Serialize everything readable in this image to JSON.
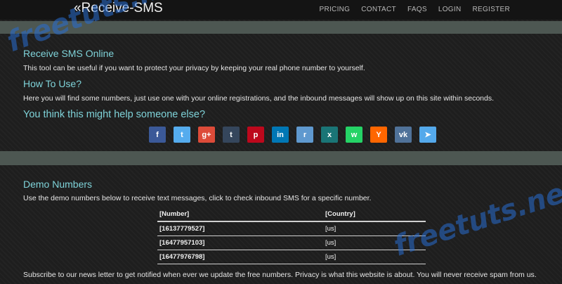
{
  "nav": {
    "brand": "«Receive-SMS",
    "items": [
      "PRICING",
      "CONTACT",
      "FAQS",
      "LOGIN",
      "REGISTER"
    ]
  },
  "intro": {
    "title": "Receive SMS Online",
    "text": "This tool can be useful if you want to protect your privacy by keeping your real phone number to yourself."
  },
  "howto": {
    "title": "How To Use?",
    "text": "Here you will find some numbers, just use one with your online registrations, and the inbound messages will show up on this site within seconds."
  },
  "share": {
    "title": "You think this might help someone else?",
    "buttons": [
      {
        "name": "facebook",
        "glyph": "f",
        "color": "#3b5998",
        "icon": "facebook-icon"
      },
      {
        "name": "twitter",
        "glyph": "t",
        "color": "#55acee",
        "icon": "twitter-icon"
      },
      {
        "name": "google-plus",
        "glyph": "g+",
        "color": "#dd4b39",
        "icon": "google-plus-icon"
      },
      {
        "name": "tumblr",
        "glyph": "t",
        "color": "#35465c",
        "icon": "tumblr-icon"
      },
      {
        "name": "pinterest",
        "glyph": "p",
        "color": "#bd081c",
        "icon": "pinterest-icon"
      },
      {
        "name": "linkedin",
        "glyph": "in",
        "color": "#0077b5",
        "icon": "linkedin-icon"
      },
      {
        "name": "reddit",
        "glyph": "r",
        "color": "#5f99cf",
        "icon": "reddit-icon"
      },
      {
        "name": "xing",
        "glyph": "x",
        "color": "#1a7576",
        "icon": "xing-icon"
      },
      {
        "name": "whatsapp",
        "glyph": "w",
        "color": "#25d366",
        "icon": "whatsapp-icon"
      },
      {
        "name": "hacker-news",
        "glyph": "Y",
        "color": "#ff6600",
        "icon": "hacker-news-icon"
      },
      {
        "name": "vk",
        "glyph": "vk",
        "color": "#507299",
        "icon": "vk-icon"
      },
      {
        "name": "telegram",
        "glyph": "➤",
        "color": "#54a9eb",
        "icon": "telegram-icon"
      }
    ]
  },
  "demo": {
    "title": "Demo Numbers",
    "text": "Use the demo numbers below to receive text messages, click to check inbound SMS for a specific number.",
    "headers": [
      "[Number]",
      "[Country]"
    ],
    "rows": [
      {
        "number": "[16137779527]",
        "country": "[us]"
      },
      {
        "number": "[16477957103]",
        "country": "[us]"
      },
      {
        "number": "[16477976798]",
        "country": "[us]"
      }
    ]
  },
  "footer_text": "Subscribe to our news letter to get notified when ever we update the free numbers. Privacy is what this website is about. You will never receive spam from us.",
  "watermark": "freetuts.net"
}
